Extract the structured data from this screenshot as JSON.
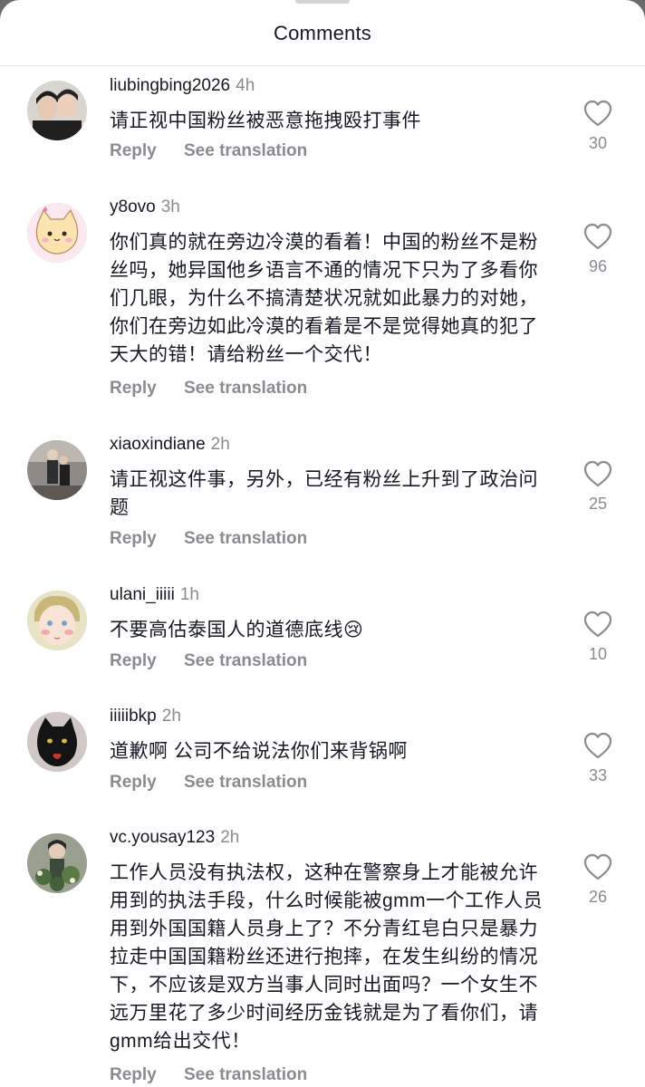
{
  "header": {
    "title": "Comments"
  },
  "labels": {
    "reply": "Reply",
    "see_translation": "See translation"
  },
  "icons": {
    "like": "heart-outline-icon"
  },
  "colors": {
    "text": "#161823",
    "muted": "#8a8b91",
    "background": "#ffffff"
  },
  "comments": [
    {
      "username": "liubingbing2026",
      "time": "4h",
      "text": "请正视中国粉丝被恶意拖拽殴打事件",
      "likes": "30"
    },
    {
      "username": "y8ovo",
      "time": "3h",
      "text": "你们真的就在旁边冷漠的看着！中国的粉丝不是粉丝吗，她异国他乡语言不通的情况下只为了多看你们几眼，为什么不搞清楚状况就如此暴力的对她，你们在旁边如此冷漠的看着是不是觉得她真的犯了天大的错！请给粉丝一个交代！",
      "likes": "96"
    },
    {
      "username": "xiaoxindiane",
      "time": "2h",
      "text": "请正视这件事，另外，已经有粉丝上升到了政治问题",
      "likes": "25"
    },
    {
      "username": "ulani_iiiii",
      "time": "1h",
      "text": "不要高估泰国人的道德底线😢",
      "likes": "10"
    },
    {
      "username": "iiiiibkp",
      "time": "2h",
      "text": "道歉啊 公司不给说法你们来背锅啊",
      "likes": "33"
    },
    {
      "username": "vc.yousay123",
      "time": "2h",
      "text": "工作人员没有执法权，这种在警察身上才能被允许用到的执法手段，什么时候能被gmm一个工作人员用到外国国籍人员身上了？不分青红皂白只是暴力拉走中国国籍粉丝还进行抱摔，在发生纠纷的情况下，不应该是双方当事人同时出面吗？一个女生不远万里花了多少时间经历金钱就是为了看你们，请gmm给出交代！",
      "likes": "26"
    }
  ]
}
